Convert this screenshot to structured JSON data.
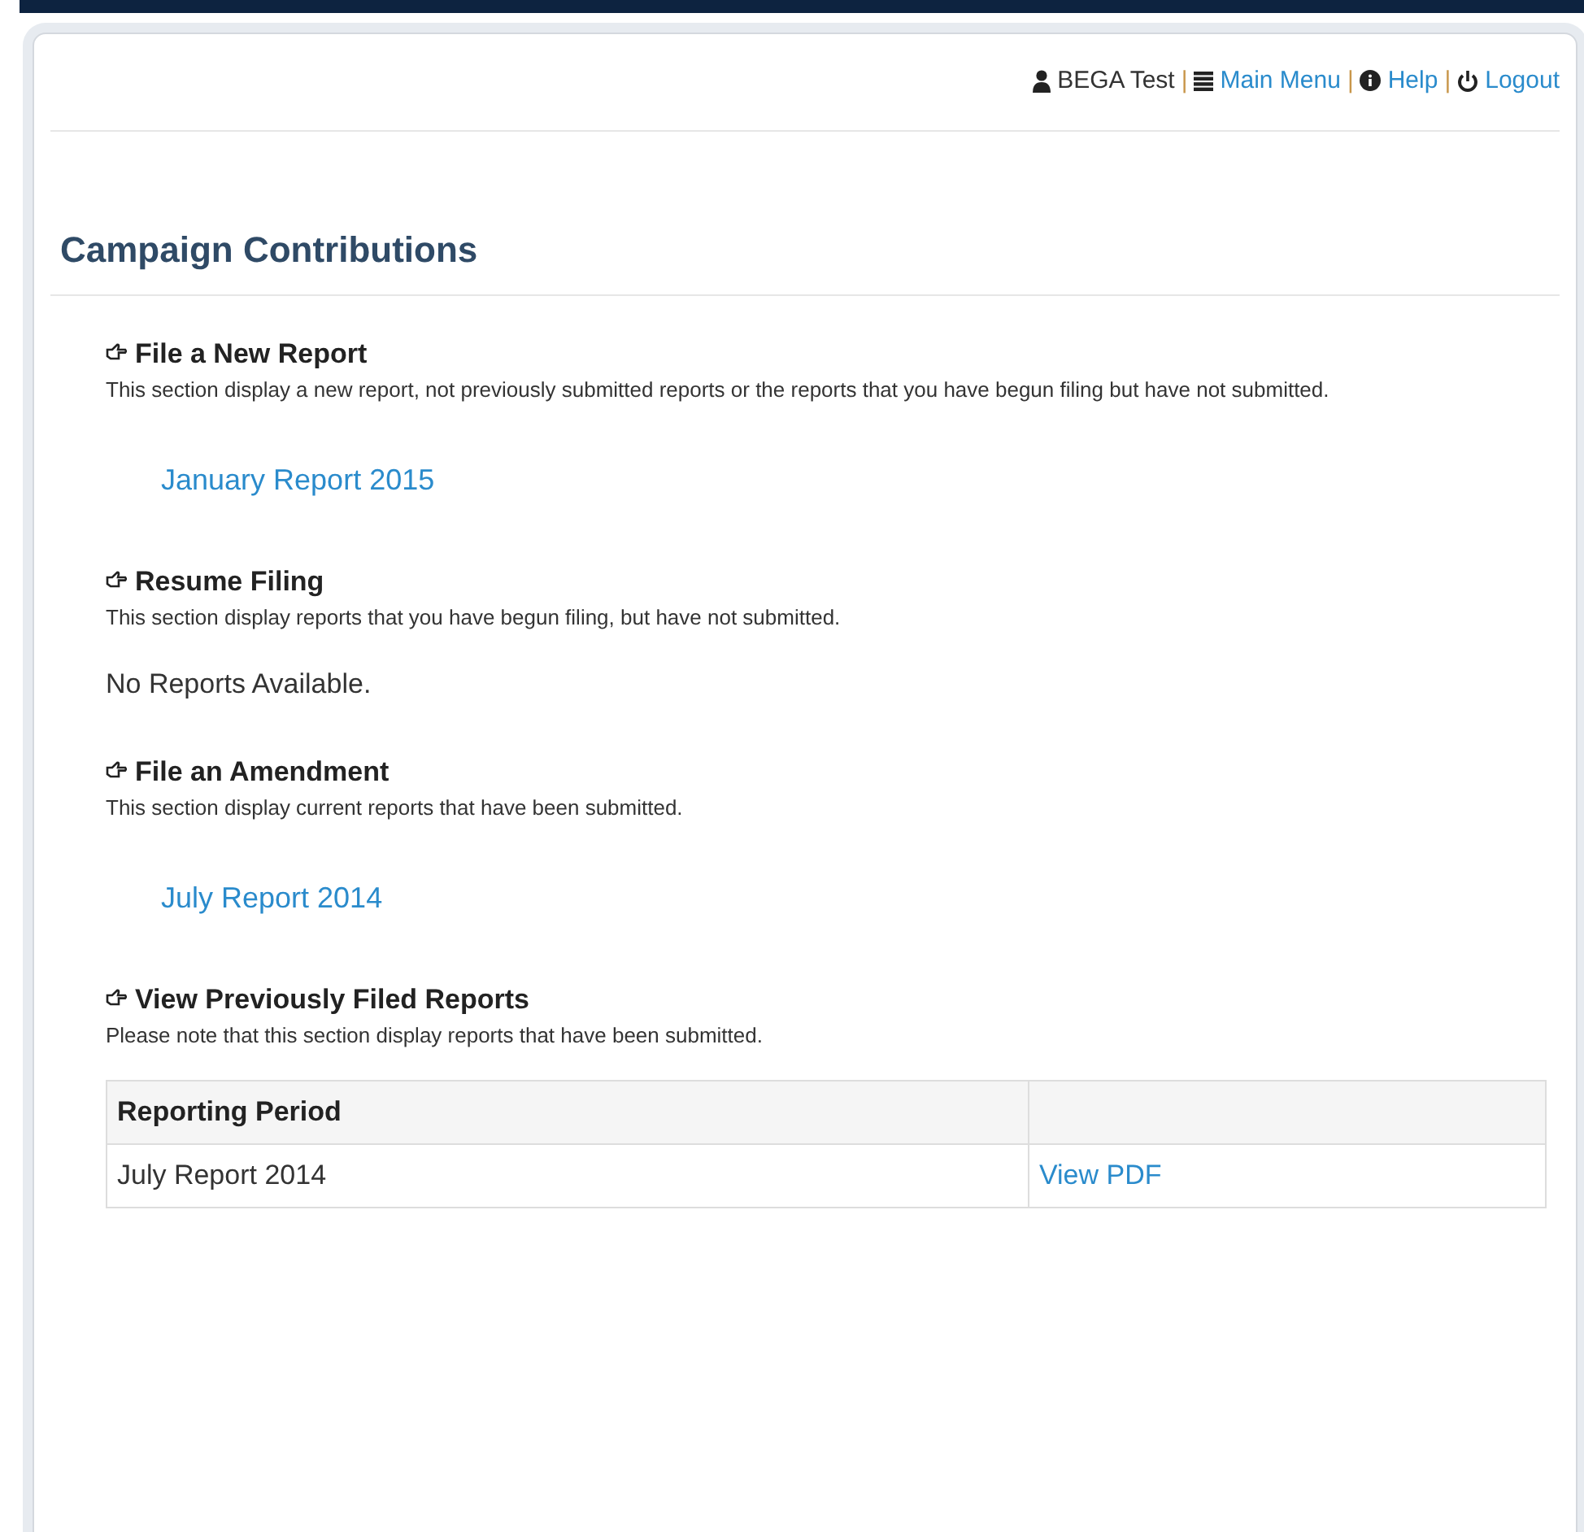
{
  "user_nav": [
    {
      "kind": "user",
      "text": "BEGA Test",
      "link": false
    },
    {
      "kind": "separator",
      "text": "|"
    },
    {
      "kind": "menu",
      "text": "Main Menu",
      "link": true
    },
    {
      "kind": "separator",
      "text": "|"
    },
    {
      "kind": "help",
      "text": "Help",
      "link": true
    },
    {
      "kind": "separator",
      "text": "|"
    },
    {
      "kind": "logout",
      "text": "Logout",
      "link": true
    }
  ],
  "page_title": "Campaign Contributions",
  "sections": [
    {
      "title": "File a New Report",
      "description": "This section display a new report, not previously submitted reports or the reports that you have begun filing but have not submitted.",
      "kind": "links",
      "links": [
        "January Report 2015"
      ]
    },
    {
      "title": "Resume Filing",
      "description": "This section display reports that you have begun filing, but have not submitted.",
      "kind": "empty",
      "message": "No Reports Available."
    },
    {
      "title": "File an Amendment",
      "description": "This section display current reports that have been submitted.",
      "kind": "links",
      "links": [
        "July Report 2014"
      ]
    },
    {
      "title": "View Previously Filed Reports",
      "description": "Please note that this section display reports that have been submitted.",
      "kind": "table",
      "columns": [
        "Reporting Period"
      ],
      "rows": [
        {
          "period": "July Report 2014",
          "action": "View PDF"
        }
      ]
    }
  ]
}
